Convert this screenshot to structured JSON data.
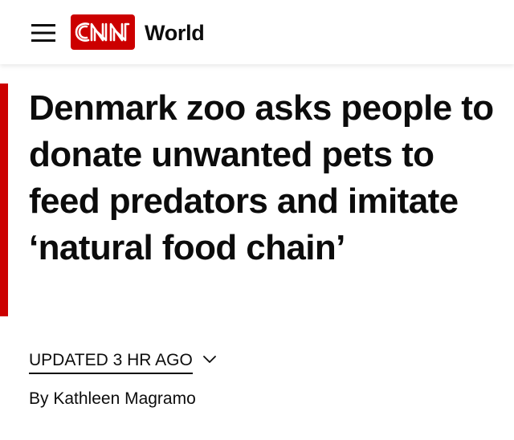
{
  "header": {
    "logo_text": "CNN",
    "logo_color": "#cc0000",
    "section_label": "World",
    "menu_icon": "hamburger-menu-icon"
  },
  "article": {
    "headline": "Denmark zoo asks people to donate unwanted pets to feed predators and imitate ‘natural food chain’",
    "accent_color": "#cc0000",
    "updated_label": "UPDATED 3 HR AGO",
    "updated_icon": "chevron-down-icon",
    "byline": "By Kathleen Magramo"
  }
}
